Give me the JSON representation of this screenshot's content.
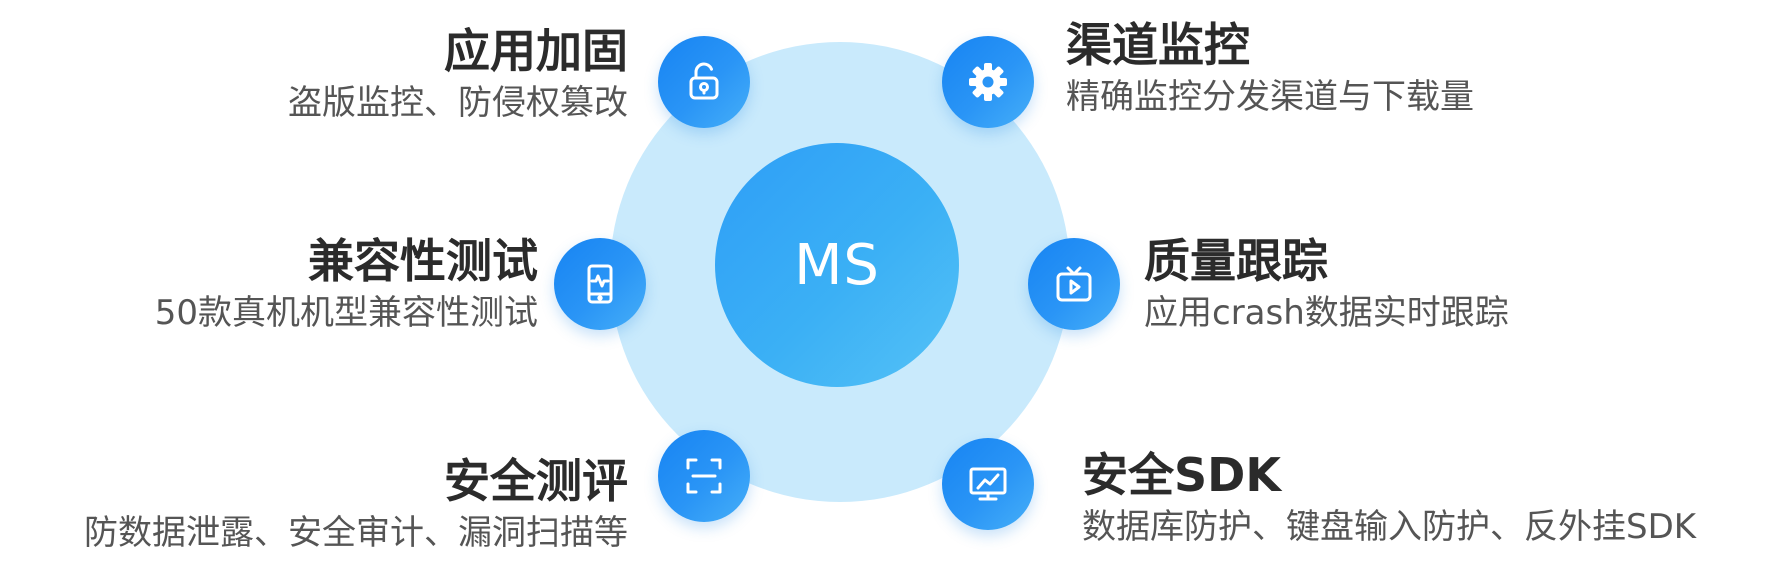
{
  "center": {
    "label": "MS"
  },
  "features": {
    "app_hardening": {
      "title": "应用加固",
      "desc": "盗版监控、防侵权篡改",
      "icon": "unlock-icon"
    },
    "compat_test": {
      "title": "兼容性测试",
      "desc": "50款真机机型兼容性测试",
      "icon": "phone-monitor-icon"
    },
    "security_eval": {
      "title": "安全测评",
      "desc": "防数据泄露、安全审计、漏洞扫描等",
      "icon": "scan-icon"
    },
    "channel_monitor": {
      "title": "渠道监控",
      "desc": "精确监控分发渠道与下载量",
      "icon": "gear-icon"
    },
    "quality_track": {
      "title": "质量跟踪",
      "desc": "应用crash数据实时跟踪",
      "icon": "tv-play-icon"
    },
    "security_sdk": {
      "title": "安全SDK",
      "desc": "数据库防护、键盘输入防护、反外挂SDK",
      "icon": "chart-monitor-icon"
    }
  },
  "colors": {
    "halo": "#c9eafc",
    "core": "#3bb0f5",
    "node": "#2a95f6",
    "title_text": "#2b2b2b",
    "desc_text": "#555555"
  }
}
